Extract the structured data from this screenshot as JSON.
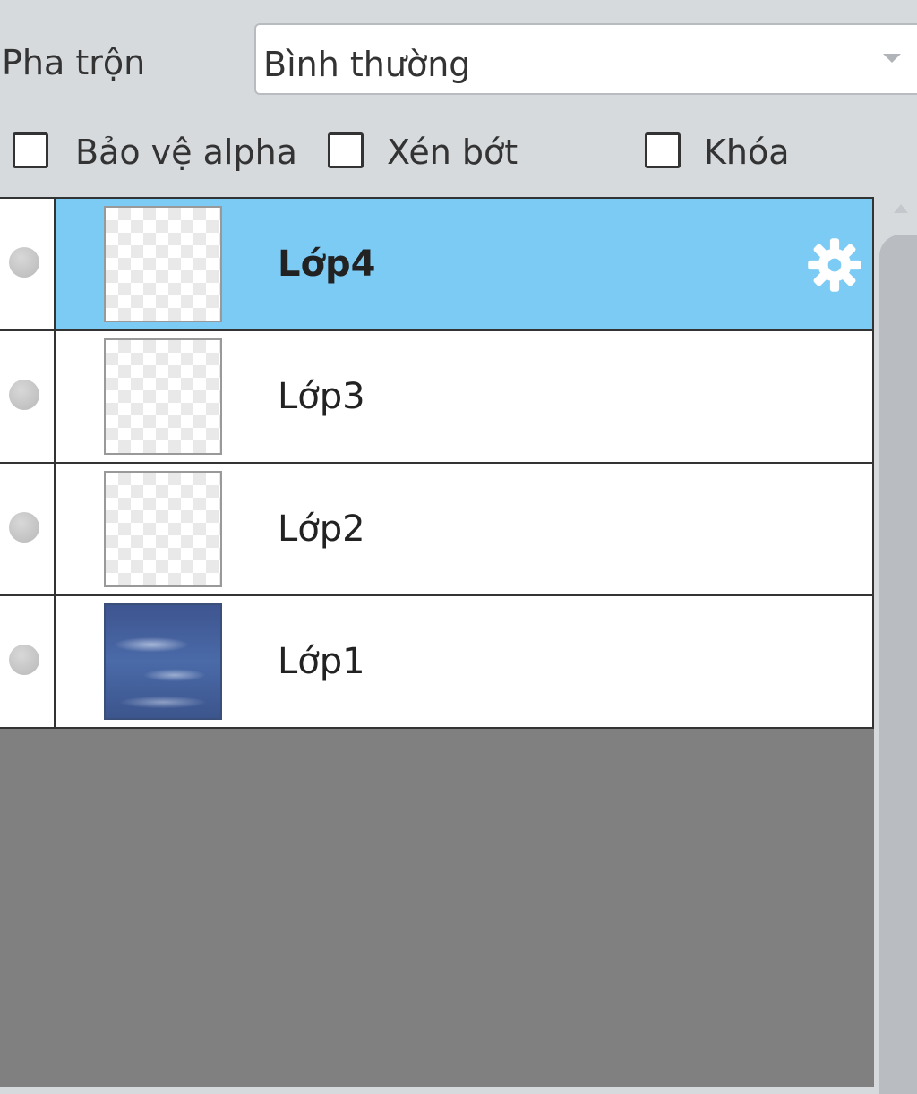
{
  "blend": {
    "label": "Pha trộn",
    "value": "Bình thường"
  },
  "options": [
    {
      "label": "Bảo vệ alpha",
      "checked": false
    },
    {
      "label": "Xén bớt",
      "checked": false
    },
    {
      "label": "Khóa",
      "checked": false
    }
  ],
  "layers": [
    {
      "name": "Lớp4",
      "selected": true,
      "thumbnail": "transparent"
    },
    {
      "name": "Lớp3",
      "selected": false,
      "thumbnail": "transparent"
    },
    {
      "name": "Lớp2",
      "selected": false,
      "thumbnail": "transparent"
    },
    {
      "name": "Lớp1",
      "selected": false,
      "thumbnail": "sky-image"
    }
  ],
  "colors": {
    "selected_row": "#7ccbf5",
    "empty_area": "#808080"
  },
  "icons": {
    "settings": "gear-icon",
    "visibility": "visibility-dot-icon",
    "dropdown": "chevron-down-icon"
  }
}
